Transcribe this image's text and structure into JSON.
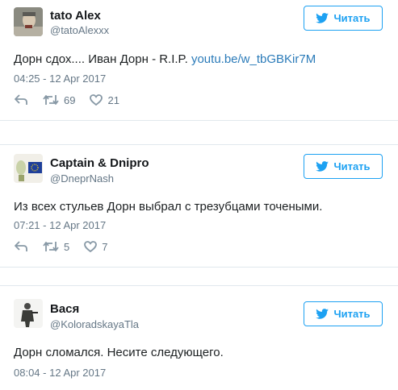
{
  "tweets": [
    {
      "name": "tato Alex",
      "handle": "@tatoAlexxx",
      "follow_label": "Читать",
      "text": "Дорн сдох.... Иван Дорн - R.I.P. ",
      "link": "youtu.be/w_tbGBKir7M",
      "date": "04:25 - 12 Apr 2017",
      "retweets": "69",
      "likes": "21"
    },
    {
      "name": "Captain & Dnipro",
      "handle": "@DneprNash",
      "follow_label": "Читать",
      "text": "Из всех стульев Дорн выбрал с трезубцами точеными.",
      "date": "07:21 - 12 Apr 2017",
      "retweets": "5",
      "likes": "7"
    },
    {
      "name": "Вася",
      "handle": "@KoloradskayaTla",
      "follow_label": "Читать",
      "text": "Дорн сломался. Несите следующего.",
      "date": "08:04 - 12 Apr 2017"
    }
  ],
  "icons": [
    "twitter-bird-icon",
    "reply-icon",
    "retweet-icon",
    "heart-icon"
  ],
  "colors": {
    "accent": "#1da1f2",
    "link": "#2b7bb9",
    "muted": "#657786"
  }
}
